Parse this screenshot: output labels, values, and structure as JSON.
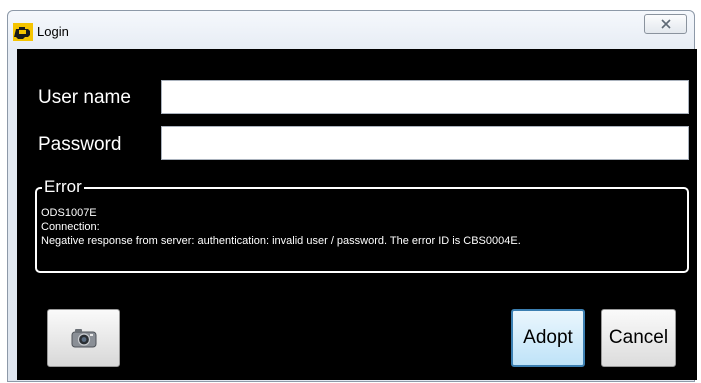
{
  "window": {
    "title": "Login",
    "close_glyph": "✕",
    "icon": "engine-warning-icon"
  },
  "form": {
    "username_label": "User name",
    "username_value": "",
    "password_label": "Password",
    "password_value": ""
  },
  "error": {
    "title": "Error",
    "lines": [
      "ODS1007E",
      "Connection:",
      "Negative response from server: authentication: invalid user / password. The error ID is CBS0004E."
    ]
  },
  "buttons": {
    "camera_icon": "camera-icon",
    "adopt_label": "Adopt",
    "cancel_label": "Cancel"
  },
  "colors": {
    "client_bg": "#000000",
    "text": "#ffffff",
    "adopt_border": "#3c7fb1",
    "icon_yellow": "#f5c400"
  }
}
